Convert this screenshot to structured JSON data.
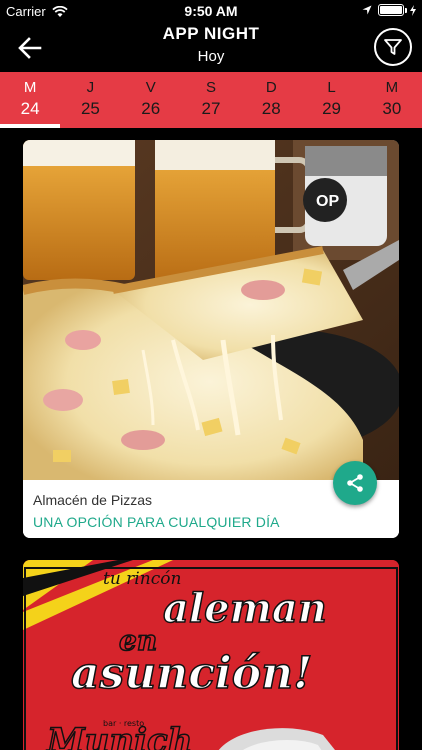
{
  "status": {
    "carrier": "Carrier",
    "time": "9:50 AM",
    "battery_level": 1.0
  },
  "header": {
    "title": "APP NIGHT",
    "subtitle": "Hoy",
    "back_icon": "arrow-left-icon",
    "filter_icon": "filter-icon"
  },
  "days": [
    {
      "letter": "M",
      "num": "24",
      "active": true
    },
    {
      "letter": "J",
      "num": "25"
    },
    {
      "letter": "V",
      "num": "26"
    },
    {
      "letter": "S",
      "num": "27"
    },
    {
      "letter": "D",
      "num": "28"
    },
    {
      "letter": "L",
      "num": "29"
    },
    {
      "letter": "M",
      "num": "30"
    }
  ],
  "colors": {
    "accent_red": "#e53b45",
    "teal": "#1fa98b",
    "card2_red": "#d6242c"
  },
  "cards": [
    {
      "title": "Almacén de Pizzas",
      "subtitle": "UNA OPCIÓN PARA CUALQUIER DÍA",
      "share_icon": "share-icon"
    },
    {
      "banner": {
        "line1": "tu rincón",
        "line2": "aleman",
        "line3": "en",
        "line4": "asunción!",
        "brand_small": "bar · resto",
        "brand": "Munich"
      }
    }
  ]
}
